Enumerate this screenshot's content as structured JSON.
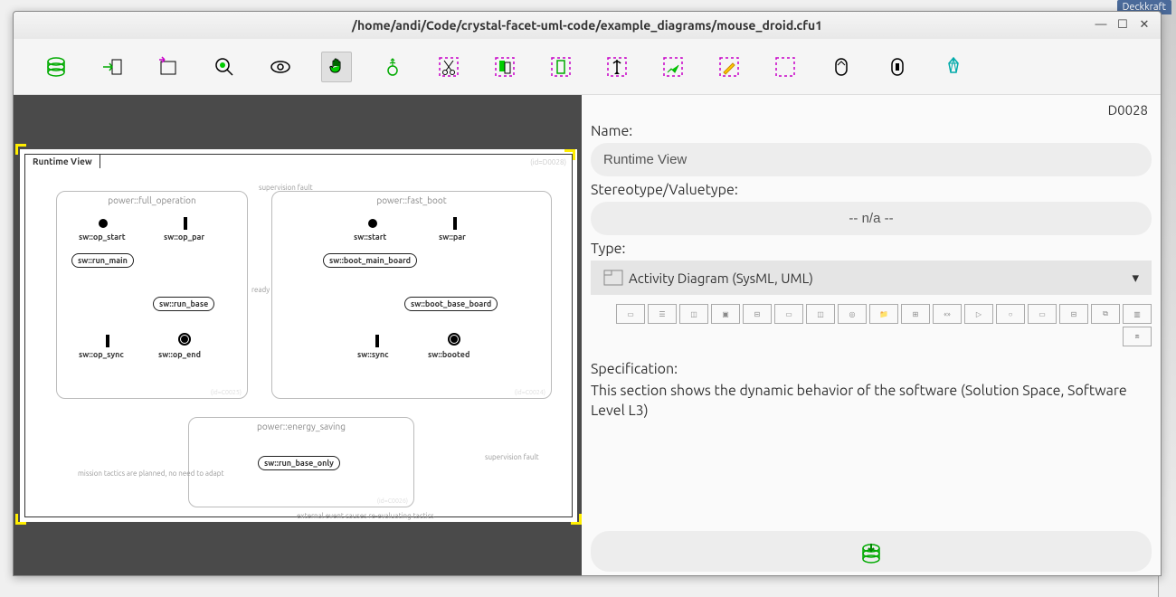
{
  "window": {
    "title": "/home/andi/Code/crystal-facet-uml-code/example_diagrams/mouse_droid.cfu1",
    "external_tab": "Deckkraft"
  },
  "toolbar": {
    "items": [
      "database-icon",
      "export-icon",
      "new-window-icon",
      "search-icon",
      "view-icon",
      "hand-icon",
      "edit-icon",
      "cut-icon",
      "copy-icon",
      "paste-icon",
      "delete-icon",
      "highlight-icon",
      "instantiate-icon",
      "reset-icon",
      "undo-icon",
      "redo-icon",
      "about-icon"
    ]
  },
  "diagram": {
    "tab_label": "Runtime View",
    "id_marker": "(id=D0028)",
    "regions": {
      "full_operation": {
        "title": "power::full_operation",
        "id": "(id=C0025)",
        "nodes": {
          "op_start": "sw::op_start",
          "op_par": "sw::op_par",
          "run_main": "sw::run_main",
          "run_base": "sw::run_base",
          "op_sync": "sw::op_sync",
          "op_end": "sw::op_end"
        }
      },
      "fast_boot": {
        "title": "power::fast_boot",
        "id": "(id=C0024)",
        "nodes": {
          "start": "sw::start",
          "par": "sw::par",
          "boot_main_board": "sw::boot_main_board",
          "boot_base_board": "sw::boot_base_board",
          "sync": "sw::sync",
          "booted": "sw::booted"
        }
      },
      "energy_saving": {
        "title": "power::energy_saving",
        "id": "(id=C0026)",
        "nodes": {
          "run_base_only": "sw::run_base_only"
        }
      }
    },
    "edges": {
      "supervision_fault": "supervision fault",
      "ready": "ready",
      "mission_tactics": "mission tactics are planned, no need to adapt",
      "external_event": "external event causes re-evaluating tactics"
    }
  },
  "panel": {
    "element_id": "D0028",
    "name_label": "Name:",
    "name_value": "Runtime View",
    "stereotype_label": "Stereotype/Valuetype:",
    "stereotype_value": "-- n/a --",
    "type_label": "Type:",
    "type_value": "Activity Diagram (SysML, UML)",
    "spec_label": "Specification:",
    "spec_text": "This section shows the dynamic behavior of the software (Solution Space, Software Level L3)"
  }
}
